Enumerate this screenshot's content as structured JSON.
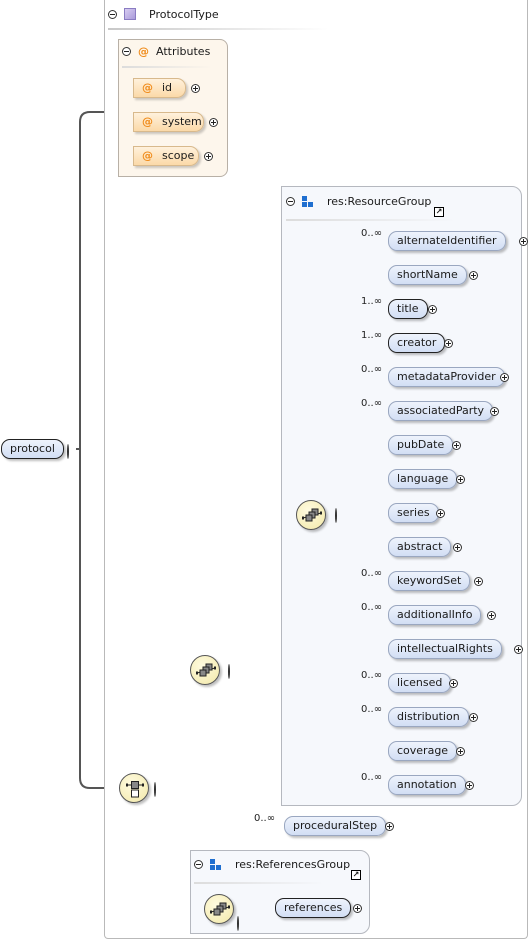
{
  "root_element": {
    "name": "protocol",
    "required": true
  },
  "complex_type": {
    "name": "ProtocolType",
    "icon": "complex-type-icon"
  },
  "attributes": {
    "title": "Attributes",
    "items": [
      {
        "name": "id"
      },
      {
        "name": "system"
      },
      {
        "name": "scope"
      }
    ]
  },
  "compositors": {
    "root": {
      "type": "choice",
      "icon": "choice-compositor-icon"
    },
    "outer_sequence": {
      "type": "sequence",
      "icon": "sequence-compositor-icon"
    },
    "resource_sequence": {
      "type": "sequence",
      "icon": "sequence-compositor-icon"
    },
    "references_sequence": {
      "type": "sequence",
      "icon": "sequence-compositor-icon"
    }
  },
  "resource_group": {
    "title": "res:ResourceGroup",
    "elements": [
      {
        "name": "alternateIdentifier",
        "cardinality": "0..∞",
        "required": false
      },
      {
        "name": "shortName",
        "cardinality": "",
        "required": false
      },
      {
        "name": "title",
        "cardinality": "1..∞",
        "required": true
      },
      {
        "name": "creator",
        "cardinality": "1..∞",
        "required": true
      },
      {
        "name": "metadataProvider",
        "cardinality": "0..∞",
        "required": false
      },
      {
        "name": "associatedParty",
        "cardinality": "0..∞",
        "required": false
      },
      {
        "name": "pubDate",
        "cardinality": "",
        "required": false
      },
      {
        "name": "language",
        "cardinality": "",
        "required": false
      },
      {
        "name": "series",
        "cardinality": "",
        "required": false
      },
      {
        "name": "abstract",
        "cardinality": "",
        "required": false
      },
      {
        "name": "keywordSet",
        "cardinality": "0..∞",
        "required": false
      },
      {
        "name": "additionalInfo",
        "cardinality": "0..∞",
        "required": false
      },
      {
        "name": "intellectualRights",
        "cardinality": "",
        "required": false
      },
      {
        "name": "licensed",
        "cardinality": "0..∞",
        "required": false
      },
      {
        "name": "distribution",
        "cardinality": "0..∞",
        "required": false
      },
      {
        "name": "coverage",
        "cardinality": "",
        "required": false
      },
      {
        "name": "annotation",
        "cardinality": "0..∞",
        "required": false
      }
    ]
  },
  "procedural_step": {
    "name": "proceduralStep",
    "cardinality": "0..∞",
    "required": false
  },
  "references_group": {
    "title": "res:ReferencesGroup",
    "elements": [
      {
        "name": "references",
        "required": true
      }
    ]
  },
  "symbols": {
    "at": "@",
    "link": "↗"
  },
  "colors": {
    "element_fill": "#d2def4",
    "attribute_fill": "#fbd9a8",
    "attribute_marker": "#f08c1c",
    "compositor_fill": "#f2e8a8",
    "group_icon": "#1f6fd0",
    "type_swatch": "#a99ad9"
  }
}
